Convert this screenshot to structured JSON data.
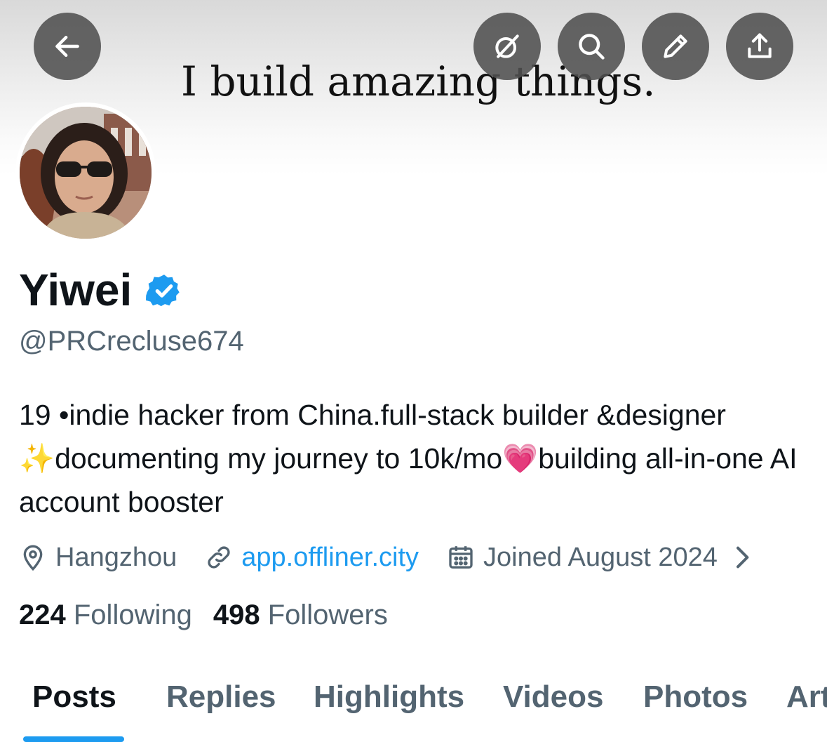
{
  "header": {
    "banner_text": "I build amazing things.",
    "buttons": [
      {
        "name": "back-button",
        "icon": "arrow-left-icon"
      },
      {
        "name": "grok-button",
        "icon": "slash-circle-icon"
      },
      {
        "name": "search-button",
        "icon": "search-icon"
      },
      {
        "name": "edit-button",
        "icon": "pencil-icon"
      },
      {
        "name": "share-button",
        "icon": "share-upload-icon"
      }
    ]
  },
  "profile": {
    "name": "Yiwei",
    "verified_icon": "verified-badge-icon",
    "handle": "@PRCrecluse674",
    "bio": {
      "line1": "19 •indie hacker from China.full-stack builder &designer",
      "sparkle_emoji": "✨",
      "line2a": "documenting my journey to 10k/mo",
      "heart_emoji": "💗",
      "line2b": "building all-in-one AI account booster"
    },
    "location": "Hangzhou",
    "website": "app.offliner.city",
    "joined": "Joined August 2024",
    "following_count": "224",
    "following_label": "Following",
    "followers_count": "498",
    "followers_label": "Followers"
  },
  "tabs": [
    {
      "label": "Posts",
      "active": true
    },
    {
      "label": "Replies",
      "active": false
    },
    {
      "label": "Highlights",
      "active": false
    },
    {
      "label": "Videos",
      "active": false
    },
    {
      "label": "Photos",
      "active": false
    },
    {
      "label": "Articles",
      "active": false
    }
  ],
  "colors": {
    "accent": "#1d9bf0",
    "text_primary": "#0f1419",
    "text_secondary": "#536471",
    "button_bg": "#505050"
  }
}
